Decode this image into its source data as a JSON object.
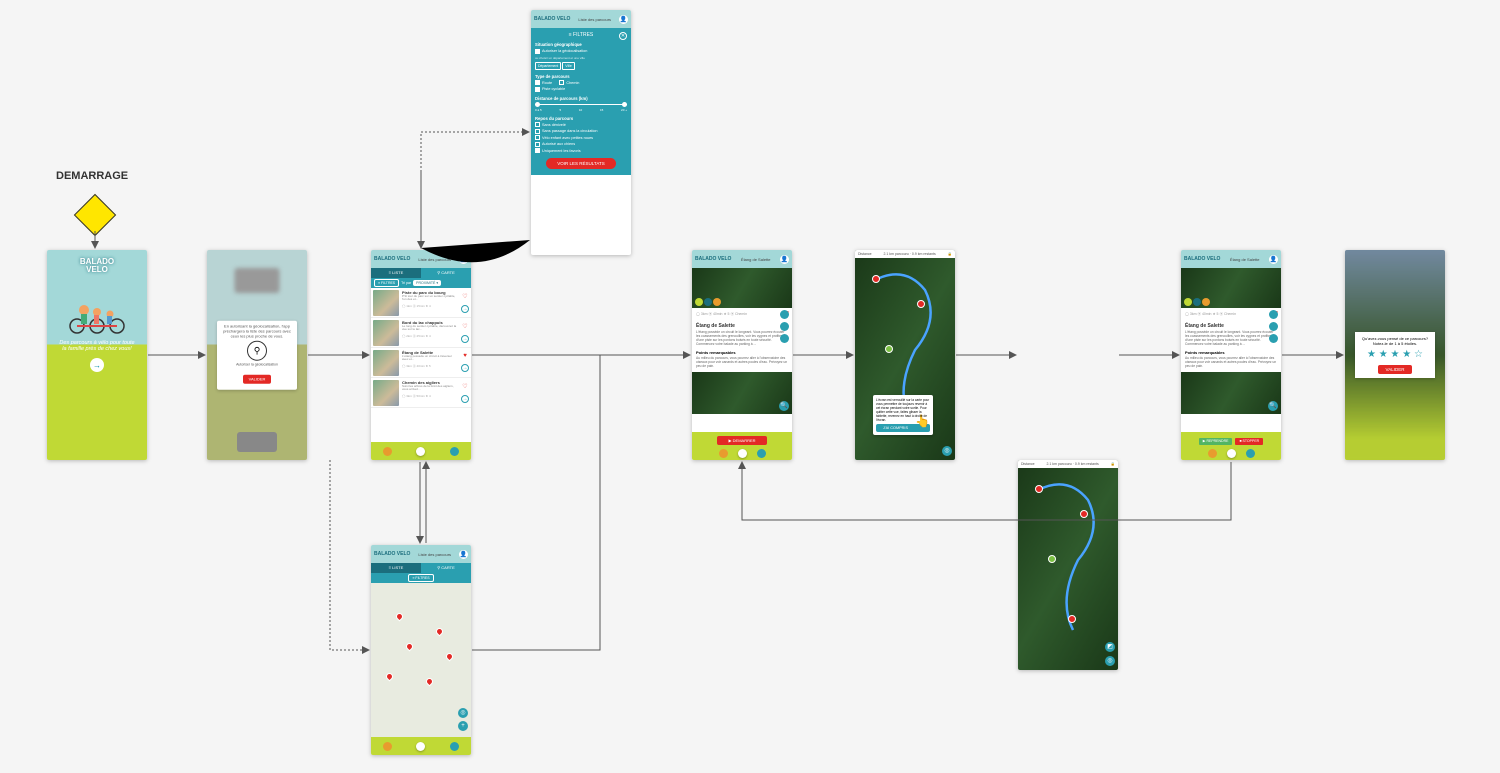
{
  "startLabel": "DEMARRAGE",
  "splash": {
    "logoTop": "BALADO",
    "logoBottom": "VELO",
    "text": "Des parcours à vélo pour toute la famille près de chez vous!"
  },
  "geoModal": {
    "text": "En autorisant la géolocalisation, l'app préchargera la liste des parcours avec ceux les plus proche de vous.",
    "checkbox": "Autoriser la géolocalisation",
    "validate": "VALIDER"
  },
  "header": {
    "logo": "BALADO VELO",
    "title": "Liste des parcours"
  },
  "tabs": {
    "list": "≡ LISTE",
    "map": "⚲ CARTE"
  },
  "filterRow": {
    "filters": "≡ FILTRES",
    "sortLabel": "Tri par",
    "sortValue": "PROXIMITÉ  ▾"
  },
  "items": [
    {
      "title": "Piste du parc du bourg",
      "sub": "P'tit tour du parc sur un sentier cyclable, l'un des et...",
      "meta": "◯ 1km   ⦿ 15min   ★ 4"
    },
    {
      "title": "Bord du lac chappuis",
      "sub": "Le long du sentier cyclable, découvrez la vue sur le lac...",
      "meta": "◯ 2km   ⦿ 25min   ★ 4"
    },
    {
      "title": "Étang de Salette",
      "sub": "L'étang possède un circuit à traverser avec et...",
      "meta": "◯ 3km   ⦿ 40min   ★ 5"
    },
    {
      "title": "Chemin des aigliers",
      "sub": "Suivi les arbres de la forêt des aigliers, vous arrivez...",
      "meta": "◯ 3km   ⦿ 50min   ★ 4"
    }
  ],
  "filtersPanel": {
    "title": "≡ FILTRES",
    "sections": {
      "geo": {
        "head": "Situation géographique",
        "allowGeo": "Autoriser la géolocalisation",
        "or": "ou choisir un département et une ville",
        "dept": "Département",
        "city": "Ville"
      },
      "type": {
        "head": "Type de parcours",
        "route": "Route",
        "chemin": "Chemin",
        "piste": "Piste cyclable"
      },
      "distance": {
        "head": "Distance de parcours (km)",
        "labels": [
          "0 à 5",
          "5",
          "10",
          "15",
          "20 +"
        ]
      },
      "repos": {
        "head": "Repos du parcours",
        "opts": [
          "Sans dénivelé",
          "Sans passage dans la circulation",
          "Vélo enfant avec petites roues",
          "Autorisé aux chiens",
          "Uniquement les favoris"
        ]
      }
    },
    "submit": "VOIR LES RÉSULTATS"
  },
  "detail": {
    "name": "Étang de Salette",
    "meta": "◯ 3km   ⦿ 40min   ★ 5   ⦿ Chemin",
    "body": "L'étang possède un circuit le longeant. Vous pourrez écouter les coassements des grenouilles, voir les cygnes et profiter d'une piste sur les pontons boisés en toute sécurité. Commencez votre balade au parking à ...",
    "landmarksHead": "Points remarquables",
    "landmarks": "Au milieu du parcours, vous pourrez aller à l'observatoire des oiseaux pour voir canards et autres poules d'eau. Prévoyez un peu de pain.",
    "startBtn": "▶  DEMARRER",
    "banner": {
      "label": "Distance",
      "value": "2.1 km parcouru · 0.9 km restants"
    },
    "tooltip": "L'écran est verrouillé sur la carte pour vous permettre de toujours revenir à cet écran pendant votre sortie. Pour quitter cette vue, faites glisser la tablette, revenez en haut à droite de l'écran.",
    "tooltipBtn": "J'AI COMPRIS",
    "reprendre": "▶ REPRENDRE",
    "stopper": "■ STOPPER"
  },
  "rating": {
    "question": "Qu'avez-vous pensé de ce parcours? Notez-le de 1 à 5 étoiles.",
    "validate": "VALIDER"
  }
}
